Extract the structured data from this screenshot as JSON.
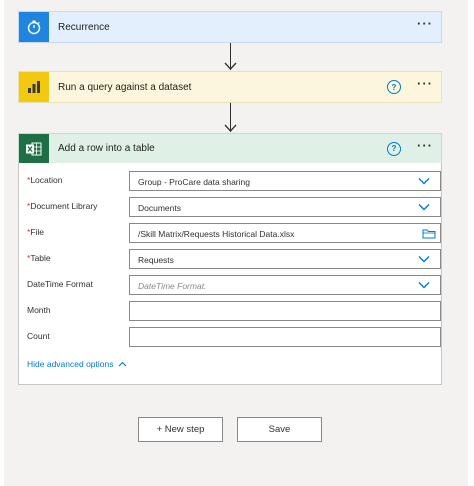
{
  "colors": {
    "recurrence_accent": "#1f85de",
    "query_accent": "#f2c811",
    "excel_accent": "#1d7044",
    "link": "#0078d4",
    "required": "#d13438"
  },
  "steps": [
    {
      "title": "Recurrence",
      "icon": "stopwatch-icon",
      "more": "···"
    },
    {
      "title": "Run a query against a dataset",
      "icon": "power-bi-icon",
      "help": "?",
      "more": "···"
    },
    {
      "title": "Add a row into a table",
      "icon": "excel-icon",
      "help": "?",
      "more": "···"
    }
  ],
  "form": {
    "required_mark": "*",
    "fields": [
      {
        "label": "Location",
        "required": true,
        "value": "Group - ProCare data sharing",
        "control": "dropdown"
      },
      {
        "label": "Document Library",
        "required": true,
        "value": "Documents",
        "control": "dropdown"
      },
      {
        "label": "File",
        "required": true,
        "value": "/Skill Matrix/Requests Historical Data.xlsx",
        "control": "file-picker"
      },
      {
        "label": "Table",
        "required": true,
        "value": "Requests",
        "control": "dropdown"
      },
      {
        "label": "DateTime Format",
        "required": false,
        "value": "",
        "placeholder": "DateTime Format.",
        "control": "dropdown"
      },
      {
        "label": "Month",
        "required": false,
        "value": "",
        "control": "text"
      },
      {
        "label": "Count",
        "required": false,
        "value": "",
        "control": "text"
      }
    ],
    "advanced_toggle": "Hide advanced options"
  },
  "actions": {
    "new_step": "+ New step",
    "save": "Save"
  }
}
